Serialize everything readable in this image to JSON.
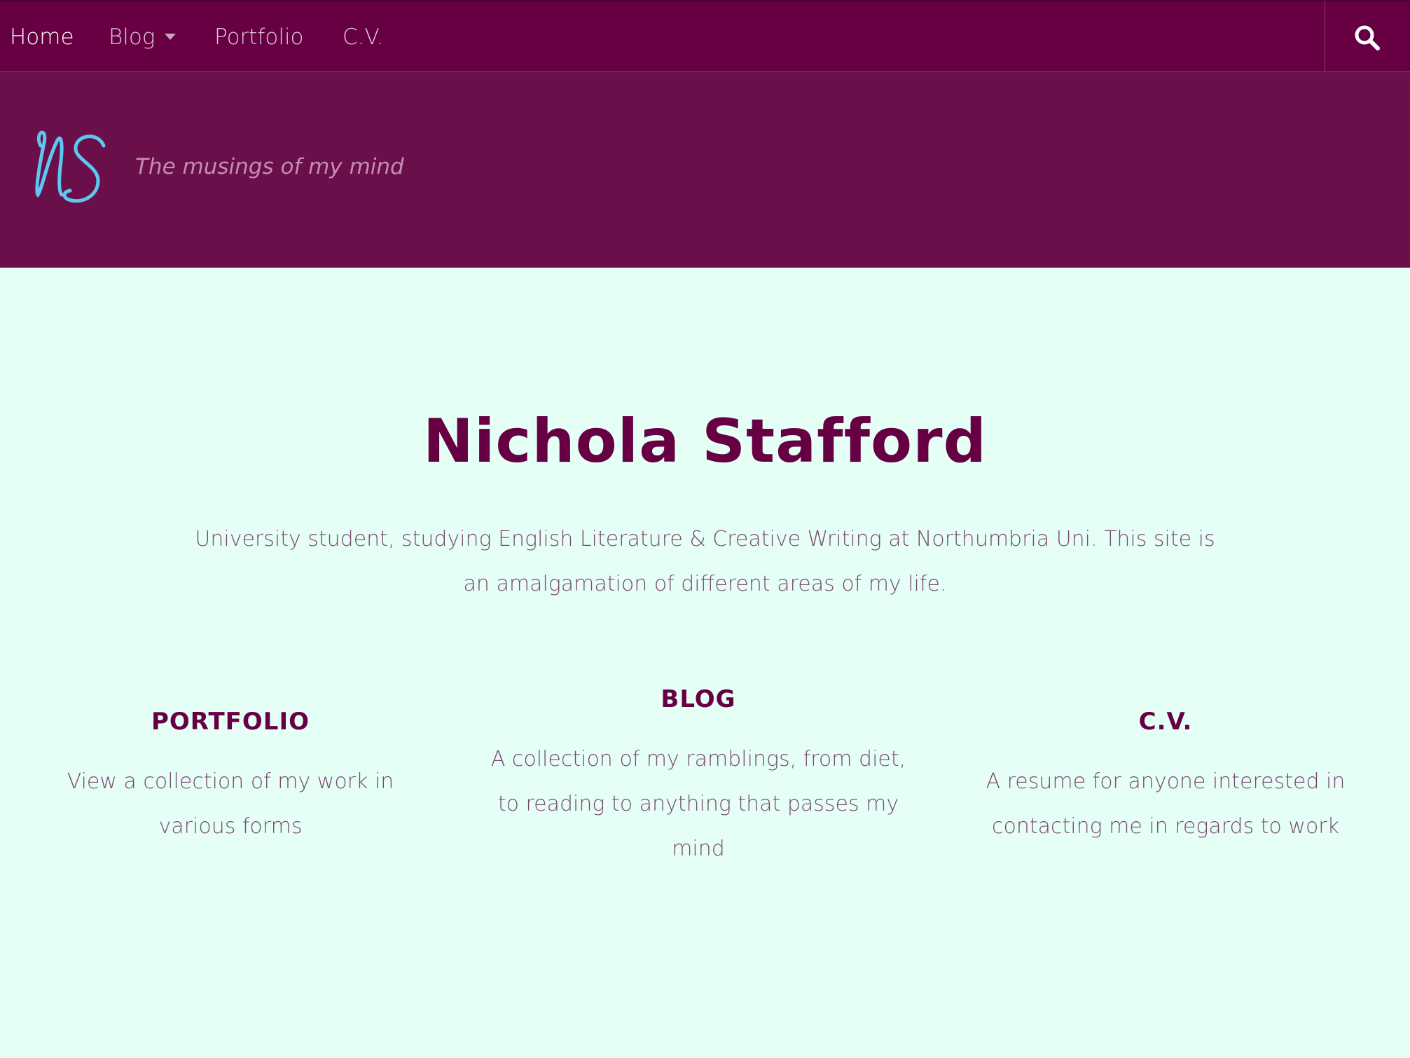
{
  "nav": {
    "items": [
      {
        "label": "Home",
        "active": true
      },
      {
        "label": "Blog",
        "has_dropdown": true
      },
      {
        "label": "Portfolio"
      },
      {
        "label": "C.V."
      }
    ],
    "search_icon": "search-icon"
  },
  "header": {
    "logo_text": "NS",
    "tagline": "The musings of my mind"
  },
  "main": {
    "title": "Nichola Stafford",
    "intro": "University student, studying English Literature & Creative Writing at Northumbria Uni. This site is an amalgamation of different areas of my life."
  },
  "columns": [
    {
      "heading": "PORTFOLIO",
      "text": "View a collection of my work in various forms"
    },
    {
      "heading": "BLOG",
      "text": "A collection of my ramblings, from diet, to reading to anything that passes my mind"
    },
    {
      "heading": "C.V.",
      "text": "A resume for anyone interested in contacting me in regards to work"
    }
  ],
  "colors": {
    "nav_bg": "#660042",
    "hero_bg": "#6b0f4b",
    "page_bg": "#e5fff7",
    "title": "#660042",
    "body_text": "#7a4a6e",
    "logo": "#5cc8f0"
  }
}
